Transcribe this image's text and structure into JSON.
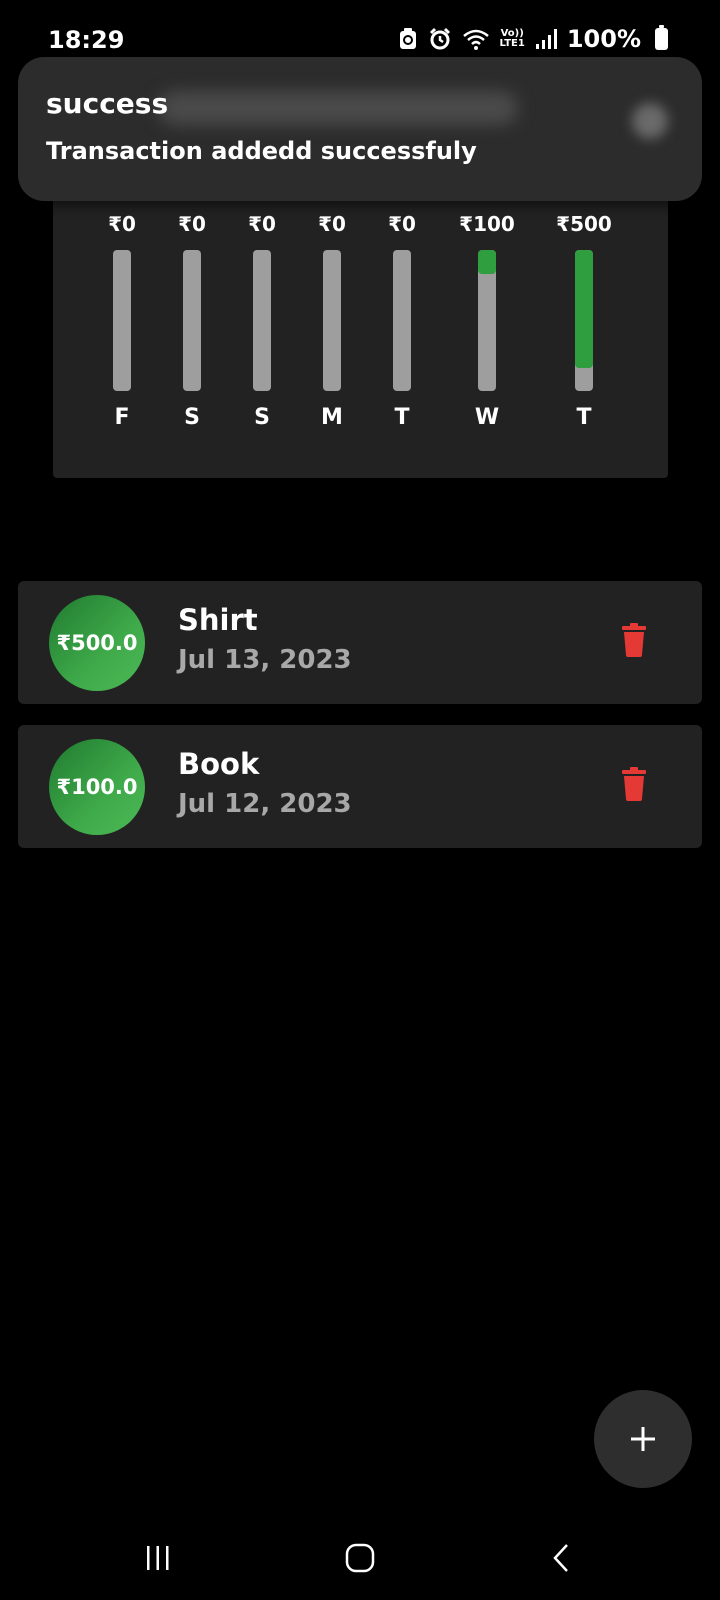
{
  "status_bar": {
    "time": "18:29",
    "lte_top": "Vo))",
    "lte_bottom": "LTE1",
    "battery": "100%",
    "icons": [
      "recycle-icon",
      "alarm-icon",
      "wifi-icon",
      "volte-icon",
      "signal-icon",
      "battery-icon"
    ]
  },
  "toast": {
    "title": "success",
    "message": "Transaction addedd successfuly"
  },
  "chart_data": {
    "type": "bar",
    "categories": [
      "F",
      "S",
      "S",
      "M",
      "T",
      "W",
      "T"
    ],
    "labels": [
      "₹0",
      "₹0",
      "₹0",
      "₹0",
      "₹0",
      "₹100",
      "₹500"
    ],
    "values": [
      0,
      0,
      0,
      0,
      0,
      100,
      500
    ],
    "ylim": [
      0,
      600
    ],
    "grid": false,
    "colors": {
      "fill": "#2e9e3e",
      "track": "#9e9e9e"
    }
  },
  "transactions": [
    {
      "amount": "₹500.0",
      "title": "Shirt",
      "date": "Jul 13, 2023"
    },
    {
      "amount": "₹100.0",
      "title": "Book",
      "date": "Jul 12, 2023"
    }
  ],
  "colors": {
    "background": "#000000",
    "card": "#222222",
    "accent_green": "#3faa4a",
    "delete_red": "#e53935",
    "muted_text": "#a8a8a8"
  },
  "fab": {
    "icon": "plus-icon"
  },
  "nav_bar": {
    "icons": [
      "recent-apps-icon",
      "home-icon",
      "back-icon"
    ]
  }
}
